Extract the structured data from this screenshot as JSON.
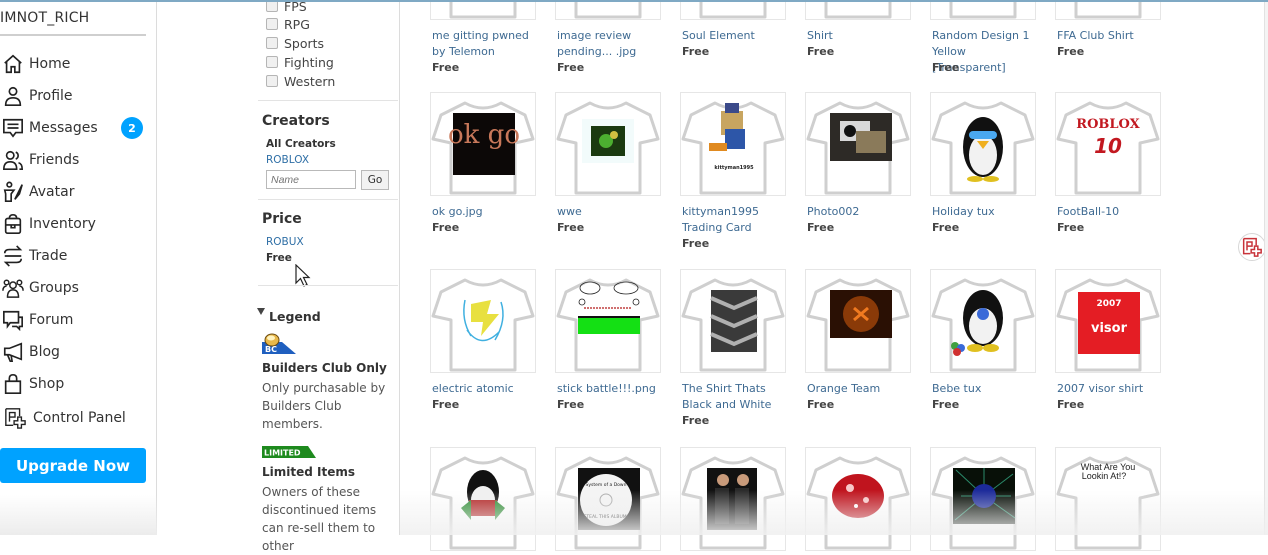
{
  "nav": {
    "username": "IMNOT_RICH",
    "items": [
      {
        "label": "Home",
        "icon": "home-icon"
      },
      {
        "label": "Profile",
        "icon": "profile-icon"
      },
      {
        "label": "Messages",
        "icon": "messages-icon",
        "badge": "2"
      },
      {
        "label": "Friends",
        "icon": "friends-icon"
      },
      {
        "label": "Avatar",
        "icon": "avatar-icon"
      },
      {
        "label": "Inventory",
        "icon": "inventory-icon"
      },
      {
        "label": "Trade",
        "icon": "trade-icon"
      },
      {
        "label": "Groups",
        "icon": "groups-icon"
      },
      {
        "label": "Forum",
        "icon": "forum-icon"
      },
      {
        "label": "Blog",
        "icon": "blog-icon"
      },
      {
        "label": "Shop",
        "icon": "shop-icon"
      },
      {
        "label": "Control Panel",
        "icon": "control-panel-icon"
      }
    ],
    "upgrade_label": "Upgrade Now"
  },
  "filters": {
    "genres": [
      "FPS",
      "RPG",
      "Sports",
      "Fighting",
      "Western"
    ],
    "creators": {
      "title": "Creators",
      "all_label": "All Creators",
      "roblox_link": "ROBLOX",
      "name_placeholder": "Name",
      "go_label": "Go"
    },
    "price": {
      "title": "Price",
      "robux_link": "ROBUX",
      "free_label": "Free"
    },
    "legend": {
      "title": "Legend",
      "bc_badge": "BC",
      "bc_title": "Builders Club Only",
      "bc_text": "Only purchasable by Builders Club members.",
      "limited_badge": "LIMITED",
      "limited_title": "Limited Items",
      "limited_text": "Owners of these discontinued items can re-sell them to other"
    }
  },
  "catalog": {
    "rows": [
      [
        {
          "name": "me gitting pwned by Telemon",
          "price": "Free"
        },
        {
          "name": "image review pending... .jpg",
          "price": "Free"
        },
        {
          "name": "Soul Element",
          "price": "Free"
        },
        {
          "name": "Shirt",
          "price": "Free"
        },
        {
          "name": "Random Design 1 Yellow [Transparent]",
          "price": "Free"
        },
        {
          "name": "FFA Club Shirt",
          "price": "Free"
        }
      ],
      [
        {
          "name": "ok go.jpg",
          "price": "Free",
          "art_text": "ok go"
        },
        {
          "name": "wwe",
          "price": "Free"
        },
        {
          "name": "kittyman1995 Trading Card",
          "price": "Free",
          "art_text": "kittyman1995"
        },
        {
          "name": "Photo002",
          "price": "Free"
        },
        {
          "name": "Holiday tux",
          "price": "Free"
        },
        {
          "name": "FootBall-10",
          "price": "Free",
          "art_text": "ROBLOX",
          "art_text2": "10"
        }
      ],
      [
        {
          "name": "electric atomic",
          "price": "Free"
        },
        {
          "name": "stick battle!!!.png",
          "price": "Free"
        },
        {
          "name": "The Shirt Thats Black and White",
          "price": "Free"
        },
        {
          "name": "Orange Team",
          "price": "Free"
        },
        {
          "name": "Bebe tux",
          "price": "Free"
        },
        {
          "name": "2007 visor shirt",
          "price": "Free",
          "art_text": "2007",
          "art_text2": "visor"
        }
      ],
      [
        {
          "name": "",
          "price": ""
        },
        {
          "name": "",
          "price": "",
          "art_text": "System of a Down",
          "art_text2": "STEAL THIS ALBUM!"
        },
        {
          "name": "",
          "price": ""
        },
        {
          "name": "",
          "price": ""
        },
        {
          "name": "",
          "price": ""
        },
        {
          "name": "",
          "price": "",
          "art_text": "What Are You",
          "art_text2": "Lookin At!?"
        }
      ]
    ]
  },
  "colors": {
    "accent": "#00a2ff",
    "link": "#3e6a92",
    "limited_green": "#1e8a1e",
    "bc_blue": "#1f5fbf"
  }
}
